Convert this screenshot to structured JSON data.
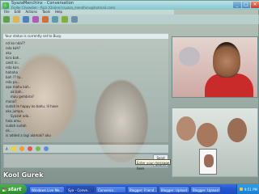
{
  "window": {
    "title": "SyazaMenchinx - Conversation",
    "subtitle": "Fieller Chowster - Rick [Online] (syaza_mendhinx@hotmail.com)"
  },
  "menu": [
    "File",
    "Edit",
    "Actions",
    "Tools",
    "Help"
  ],
  "conversation": {
    "to_label": "Your status is currently set to Busy.",
    "messages": [
      {
        "text": "nd ko nda??",
        "indent": false
      },
      {
        "text": "nda kah?",
        "indent": false
      },
      {
        "text": "aku",
        "indent": false
      },
      {
        "text": "kira bah..",
        "indent": false
      },
      {
        "text": "sakit ni..",
        "indent": false
      },
      {
        "text": "nda kan..",
        "indent": false
      },
      {
        "text": "hahaha",
        "indent": false
      },
      {
        "text": "bah ?? tu..",
        "indent": false
      },
      {
        "text": "nda pa...",
        "indent": false
      },
      {
        "text": "apa mahu kah..",
        "indent": false
      },
      {
        "text": "ok bah..",
        "indent": true
      },
      {
        "text": "mau gembira?",
        "indent": true
      },
      {
        "text": "mana?",
        "indent": false
      },
      {
        "text": "sudah le happy ko bahu, lil have",
        "indent": false
      },
      {
        "text": "aku jumpa..",
        "indent": false
      },
      {
        "text": "Syazat ada..",
        "indent": true
      },
      {
        "text": "hala amu",
        "indent": false
      },
      {
        "text": "sudah sudah",
        "indent": false
      },
      {
        "text": "ok....",
        "indent": false
      },
      {
        "text": "is added a lagi alamak? aku",
        "indent": false
      }
    ]
  },
  "format_bar": {
    "font_label": "A"
  },
  "send_label": "Send",
  "search_label": "Search",
  "tooltip": "Enter your message here",
  "background_text": "Kool Gurek",
  "taskbar": {
    "start_label": "start",
    "tasks": [
      {
        "label": "Windows Live Me...",
        "active": false
      },
      {
        "label": "Sya - Conve...",
        "active": true
      },
      {
        "label": "Conversa...",
        "active": false
      },
      {
        "label": "Blogger: Friend...",
        "active": false
      },
      {
        "label": "Blogger: Upload i...",
        "active": false
      },
      {
        "label": "Blogger: Upload I...",
        "active": false
      }
    ],
    "clock": "9:51 PM"
  }
}
